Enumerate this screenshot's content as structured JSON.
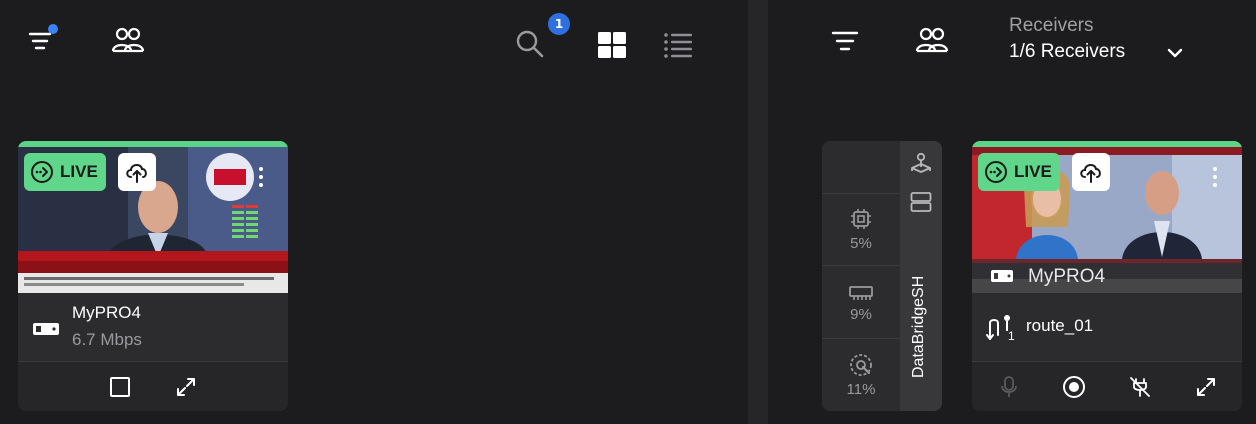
{
  "left_toolbar": {
    "filter_icon": "filter-lines-icon",
    "users_icon": "users-icon",
    "search_icon": "search-icon",
    "search_badge": "1",
    "grid_icon": "grid-view-icon",
    "list_icon": "list-view-icon"
  },
  "source_card": {
    "live_label": "LIVE",
    "device_name": "MyPRO4",
    "bitrate": "6.7 Mbps",
    "accent_color": "#5ad486"
  },
  "receivers": {
    "title": "Receivers",
    "selected": "1/6 Receivers"
  },
  "stats_card": {
    "cpu": "5%",
    "memory": "9%",
    "disk": "11%",
    "server_name": "DataBridgeSH"
  },
  "receiver_card": {
    "live_label": "LIVE",
    "device_name": "MyPRO4",
    "route_name": "route_01",
    "route_index": "1"
  }
}
